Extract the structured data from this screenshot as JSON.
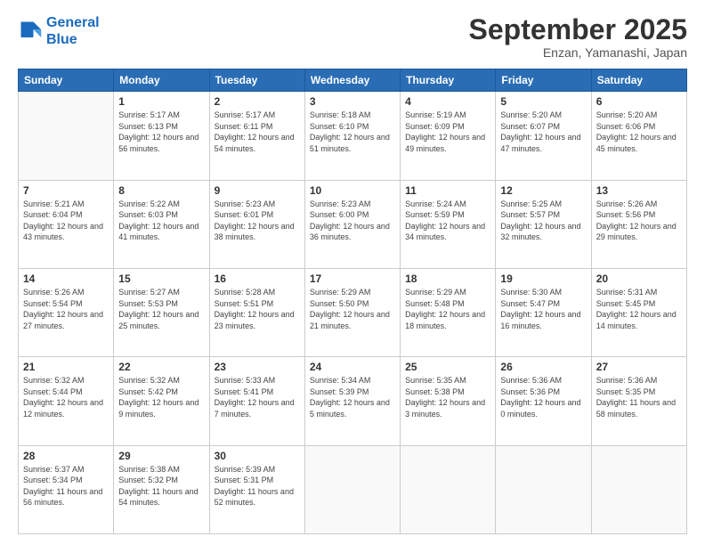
{
  "logo": {
    "line1": "General",
    "line2": "Blue"
  },
  "header": {
    "month": "September 2025",
    "location": "Enzan, Yamanashi, Japan"
  },
  "weekdays": [
    "Sunday",
    "Monday",
    "Tuesday",
    "Wednesday",
    "Thursday",
    "Friday",
    "Saturday"
  ],
  "weeks": [
    [
      {
        "day": "",
        "sunrise": "",
        "sunset": "",
        "daylight": ""
      },
      {
        "day": "1",
        "sunrise": "Sunrise: 5:17 AM",
        "sunset": "Sunset: 6:13 PM",
        "daylight": "Daylight: 12 hours and 56 minutes."
      },
      {
        "day": "2",
        "sunrise": "Sunrise: 5:17 AM",
        "sunset": "Sunset: 6:11 PM",
        "daylight": "Daylight: 12 hours and 54 minutes."
      },
      {
        "day": "3",
        "sunrise": "Sunrise: 5:18 AM",
        "sunset": "Sunset: 6:10 PM",
        "daylight": "Daylight: 12 hours and 51 minutes."
      },
      {
        "day": "4",
        "sunrise": "Sunrise: 5:19 AM",
        "sunset": "Sunset: 6:09 PM",
        "daylight": "Daylight: 12 hours and 49 minutes."
      },
      {
        "day": "5",
        "sunrise": "Sunrise: 5:20 AM",
        "sunset": "Sunset: 6:07 PM",
        "daylight": "Daylight: 12 hours and 47 minutes."
      },
      {
        "day": "6",
        "sunrise": "Sunrise: 5:20 AM",
        "sunset": "Sunset: 6:06 PM",
        "daylight": "Daylight: 12 hours and 45 minutes."
      }
    ],
    [
      {
        "day": "7",
        "sunrise": "Sunrise: 5:21 AM",
        "sunset": "Sunset: 6:04 PM",
        "daylight": "Daylight: 12 hours and 43 minutes."
      },
      {
        "day": "8",
        "sunrise": "Sunrise: 5:22 AM",
        "sunset": "Sunset: 6:03 PM",
        "daylight": "Daylight: 12 hours and 41 minutes."
      },
      {
        "day": "9",
        "sunrise": "Sunrise: 5:23 AM",
        "sunset": "Sunset: 6:01 PM",
        "daylight": "Daylight: 12 hours and 38 minutes."
      },
      {
        "day": "10",
        "sunrise": "Sunrise: 5:23 AM",
        "sunset": "Sunset: 6:00 PM",
        "daylight": "Daylight: 12 hours and 36 minutes."
      },
      {
        "day": "11",
        "sunrise": "Sunrise: 5:24 AM",
        "sunset": "Sunset: 5:59 PM",
        "daylight": "Daylight: 12 hours and 34 minutes."
      },
      {
        "day": "12",
        "sunrise": "Sunrise: 5:25 AM",
        "sunset": "Sunset: 5:57 PM",
        "daylight": "Daylight: 12 hours and 32 minutes."
      },
      {
        "day": "13",
        "sunrise": "Sunrise: 5:26 AM",
        "sunset": "Sunset: 5:56 PM",
        "daylight": "Daylight: 12 hours and 29 minutes."
      }
    ],
    [
      {
        "day": "14",
        "sunrise": "Sunrise: 5:26 AM",
        "sunset": "Sunset: 5:54 PM",
        "daylight": "Daylight: 12 hours and 27 minutes."
      },
      {
        "day": "15",
        "sunrise": "Sunrise: 5:27 AM",
        "sunset": "Sunset: 5:53 PM",
        "daylight": "Daylight: 12 hours and 25 minutes."
      },
      {
        "day": "16",
        "sunrise": "Sunrise: 5:28 AM",
        "sunset": "Sunset: 5:51 PM",
        "daylight": "Daylight: 12 hours and 23 minutes."
      },
      {
        "day": "17",
        "sunrise": "Sunrise: 5:29 AM",
        "sunset": "Sunset: 5:50 PM",
        "daylight": "Daylight: 12 hours and 21 minutes."
      },
      {
        "day": "18",
        "sunrise": "Sunrise: 5:29 AM",
        "sunset": "Sunset: 5:48 PM",
        "daylight": "Daylight: 12 hours and 18 minutes."
      },
      {
        "day": "19",
        "sunrise": "Sunrise: 5:30 AM",
        "sunset": "Sunset: 5:47 PM",
        "daylight": "Daylight: 12 hours and 16 minutes."
      },
      {
        "day": "20",
        "sunrise": "Sunrise: 5:31 AM",
        "sunset": "Sunset: 5:45 PM",
        "daylight": "Daylight: 12 hours and 14 minutes."
      }
    ],
    [
      {
        "day": "21",
        "sunrise": "Sunrise: 5:32 AM",
        "sunset": "Sunset: 5:44 PM",
        "daylight": "Daylight: 12 hours and 12 minutes."
      },
      {
        "day": "22",
        "sunrise": "Sunrise: 5:32 AM",
        "sunset": "Sunset: 5:42 PM",
        "daylight": "Daylight: 12 hours and 9 minutes."
      },
      {
        "day": "23",
        "sunrise": "Sunrise: 5:33 AM",
        "sunset": "Sunset: 5:41 PM",
        "daylight": "Daylight: 12 hours and 7 minutes."
      },
      {
        "day": "24",
        "sunrise": "Sunrise: 5:34 AM",
        "sunset": "Sunset: 5:39 PM",
        "daylight": "Daylight: 12 hours and 5 minutes."
      },
      {
        "day": "25",
        "sunrise": "Sunrise: 5:35 AM",
        "sunset": "Sunset: 5:38 PM",
        "daylight": "Daylight: 12 hours and 3 minutes."
      },
      {
        "day": "26",
        "sunrise": "Sunrise: 5:36 AM",
        "sunset": "Sunset: 5:36 PM",
        "daylight": "Daylight: 12 hours and 0 minutes."
      },
      {
        "day": "27",
        "sunrise": "Sunrise: 5:36 AM",
        "sunset": "Sunset: 5:35 PM",
        "daylight": "Daylight: 11 hours and 58 minutes."
      }
    ],
    [
      {
        "day": "28",
        "sunrise": "Sunrise: 5:37 AM",
        "sunset": "Sunset: 5:34 PM",
        "daylight": "Daylight: 11 hours and 56 minutes."
      },
      {
        "day": "29",
        "sunrise": "Sunrise: 5:38 AM",
        "sunset": "Sunset: 5:32 PM",
        "daylight": "Daylight: 11 hours and 54 minutes."
      },
      {
        "day": "30",
        "sunrise": "Sunrise: 5:39 AM",
        "sunset": "Sunset: 5:31 PM",
        "daylight": "Daylight: 11 hours and 52 minutes."
      },
      {
        "day": "",
        "sunrise": "",
        "sunset": "",
        "daylight": ""
      },
      {
        "day": "",
        "sunrise": "",
        "sunset": "",
        "daylight": ""
      },
      {
        "day": "",
        "sunrise": "",
        "sunset": "",
        "daylight": ""
      },
      {
        "day": "",
        "sunrise": "",
        "sunset": "",
        "daylight": ""
      }
    ]
  ]
}
